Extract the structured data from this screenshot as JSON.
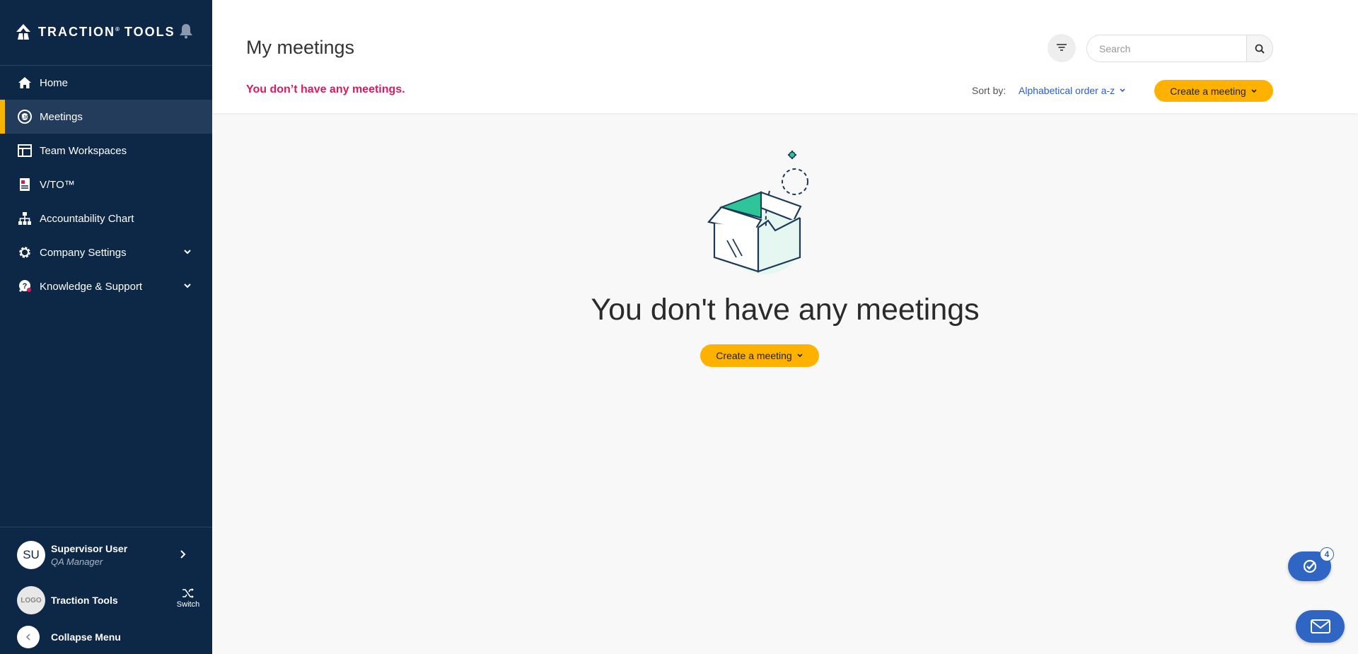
{
  "sidebar": {
    "brand": "TRACTION",
    "brand_mark": "®",
    "brand_suffix": "TOOLS",
    "nav": [
      {
        "label": "Home",
        "icon": "home-icon"
      },
      {
        "label": "Meetings",
        "icon": "meetings-icon",
        "active": true
      },
      {
        "label": "Team Workspaces",
        "icon": "workspace-icon"
      },
      {
        "label": "V/TO™",
        "icon": "vto-icon"
      },
      {
        "label": "Accountability Chart",
        "icon": "org-chart-icon"
      },
      {
        "label": "Company Settings",
        "icon": "gear-icon",
        "expandable": true
      },
      {
        "label": "Knowledge & Support",
        "icon": "support-icon",
        "expandable": true
      }
    ],
    "user": {
      "initials": "SU",
      "name": "Supervisor User",
      "role": "QA Manager"
    },
    "org": {
      "logo_text": "LOGO",
      "name": "Traction Tools",
      "switch_label": "Switch"
    },
    "collapse_label": "Collapse Menu"
  },
  "header": {
    "title": "My meetings",
    "empty_message": "You don’t have any meetings.",
    "search_placeholder": "Search",
    "sort_label": "Sort by:",
    "sort_value": "Alphabetical order a-z",
    "create_label": "Create a meeting"
  },
  "empty_state": {
    "title": "You don't have any meetings",
    "create_label": "Create a meeting"
  },
  "fab": {
    "tasks_badge": "4"
  },
  "colors": {
    "sidebar_bg": "#0d2847",
    "active_accent": "#f5b400",
    "cta": "#ffb100",
    "error_text": "#d81b60",
    "link": "#2b5fc7",
    "fab": "#3066c3"
  }
}
